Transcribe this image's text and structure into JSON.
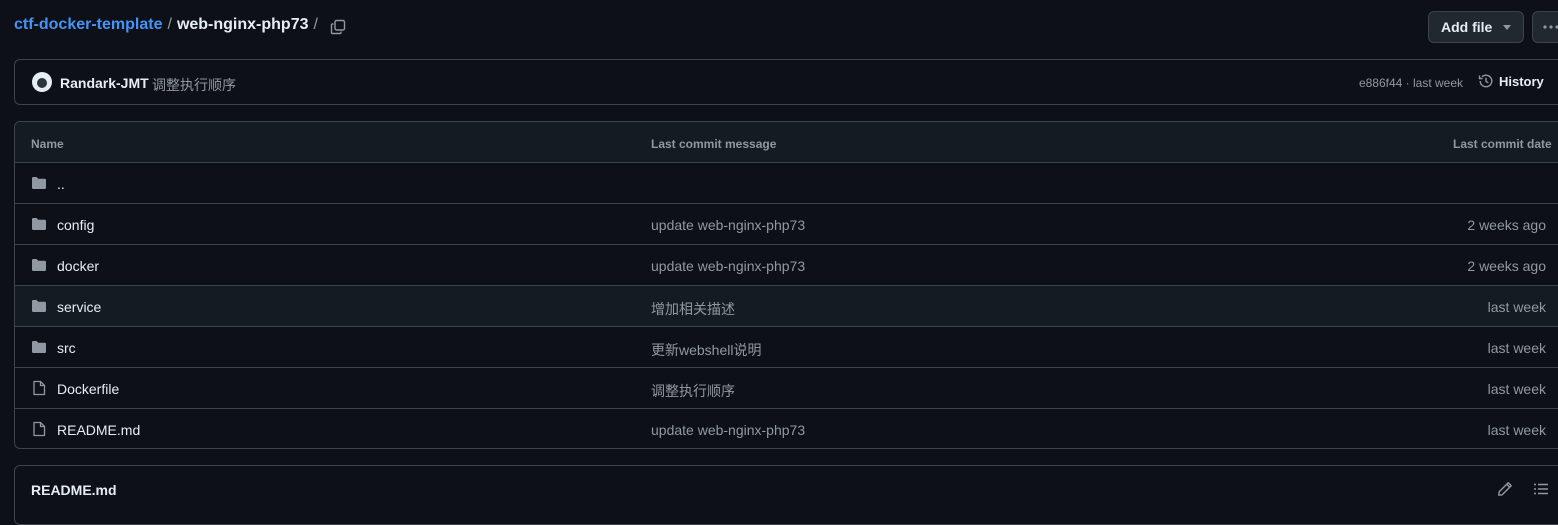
{
  "breadcrumb": {
    "repo": "ctf-docker-template",
    "separator": "/",
    "current": "web-nginx-php73",
    "trailing_separator": "/"
  },
  "toolbar": {
    "add_file_label": "Add file",
    "copy_icon": "copy-icon",
    "more_icon": "kebab-horizontal-icon"
  },
  "latest_commit": {
    "author": "Randark-JMT",
    "message": "调整执行顺序",
    "meta": "e886f44 · last week",
    "history_label": "History"
  },
  "table": {
    "headers": {
      "name": "Name",
      "message": "Last commit message",
      "date": "Last commit date"
    },
    "rows": [
      {
        "type": "folder",
        "name": "..",
        "message": "",
        "date": ""
      },
      {
        "type": "folder",
        "name": "config",
        "message": "update web-nginx-php73",
        "date": "2 weeks ago"
      },
      {
        "type": "folder",
        "name": "docker",
        "message": "update web-nginx-php73",
        "date": "2 weeks ago"
      },
      {
        "type": "folder",
        "name": "service",
        "message": "增加相关描述",
        "date": "last week"
      },
      {
        "type": "folder",
        "name": "src",
        "message": "更新webshell说明",
        "date": "last week"
      },
      {
        "type": "file",
        "name": "Dockerfile",
        "message": "调整执行顺序",
        "date": "last week"
      },
      {
        "type": "file",
        "name": "README.md",
        "message": "update web-nginx-php73",
        "date": "last week"
      }
    ]
  },
  "readme": {
    "title": "README.md"
  },
  "colors": {
    "background": "#0d1117",
    "header_bg": "#151b23",
    "border": "#3d444d",
    "link": "#4493f8",
    "text": "#e6edf3",
    "muted": "#9198a1"
  }
}
